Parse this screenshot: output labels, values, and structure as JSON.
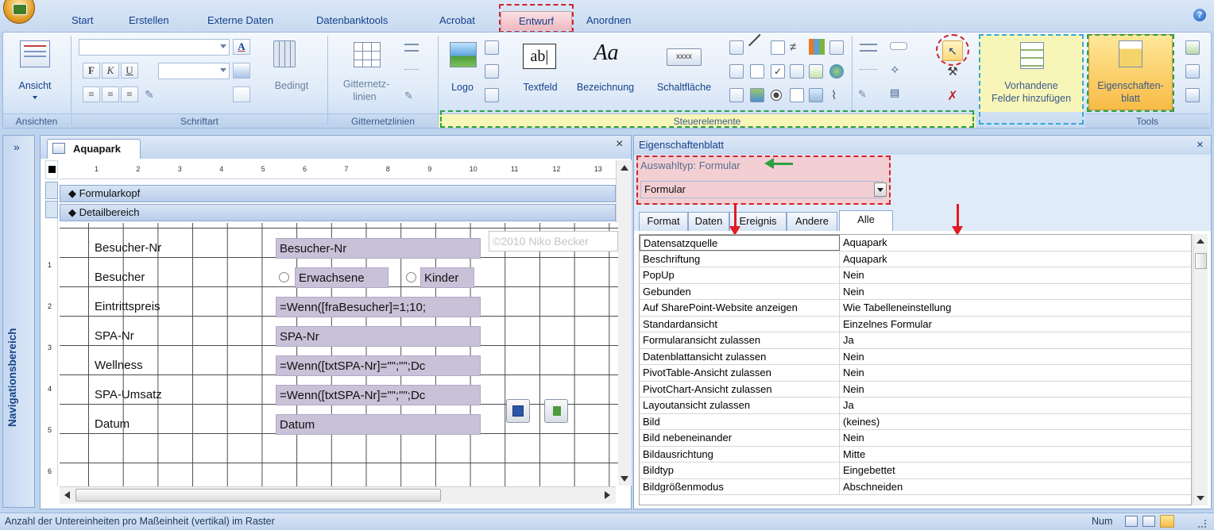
{
  "tabs": [
    "Start",
    "Erstellen",
    "Externe Daten",
    "Datenbanktools",
    "Acrobat",
    "Entwurf",
    "Anordnen"
  ],
  "active_tab": "Entwurf",
  "ribbon": {
    "ansichten": {
      "button": "Ansicht",
      "group": "Ansichten"
    },
    "schriftart": {
      "group": "Schriftart",
      "bold": "F",
      "italic": "K",
      "underline": "U",
      "bedingt": "Bedingt"
    },
    "gitternetz": {
      "button_line1": "Gitternetz-",
      "button_line2": "linien",
      "group": "Gitternetzlinien"
    },
    "steuerelemente": {
      "logo": "Logo",
      "textfeld": "Textfeld",
      "bezeichnung": "Bezeichnung",
      "schaltflaeche": "Schaltfläche",
      "textfeld_glyph": "ab|",
      "bezeichnung_glyph": "Aa",
      "schaltflaeche_glyph": "xxxx",
      "group": "Steuerelemente"
    },
    "tools": {
      "vorhandene_line1": "Vorhandene",
      "vorhandene_line2": "Felder hinzufügen",
      "eigenschaften_line1": "Eigenschaften-",
      "eigenschaften_line2": "blatt",
      "group": "Tools"
    }
  },
  "nav_pane": {
    "title": "Navigationsbereich",
    "collapse": "»"
  },
  "document": {
    "tab_title": "Aquapark",
    "close": "×",
    "sections": {
      "header": "Formularkopf",
      "detail": "Detailbereich"
    },
    "ruler_numbers": [
      "1",
      "2",
      "3",
      "4",
      "5",
      "6",
      "7",
      "8",
      "9",
      "10",
      "11",
      "12",
      "13"
    ],
    "vruler_numbers": [
      "1",
      "2",
      "3",
      "4",
      "5",
      "6"
    ],
    "watermark": "©2010 Niko Becker",
    "labels": [
      "Besucher-Nr",
      "Besucher",
      "Eintrittspreis",
      "SPA-Nr",
      "Wellness",
      "SPA-Umsatz",
      "Datum"
    ],
    "fields": {
      "besucher_nr": "Besucher-Nr",
      "option_erwachsene": "Erwachsene",
      "option_kinder": "Kinder",
      "eintrittspreis": "=Wenn([fraBesucher]=1;10;",
      "spa_nr": "SPA-Nr",
      "wellness": "=Wenn([txtSPA-Nr]=\"\";\"\";Dc",
      "spa_umsatz": "=Wenn([txtSPA-Nr]=\"\";\"\";Dc",
      "datum": "Datum"
    }
  },
  "property_sheet": {
    "title": "Eigenschaftenblatt",
    "close": "×",
    "selection_type": "Auswahltyp:  Formular",
    "selector_value": "Formular",
    "tabs": [
      "Format",
      "Daten",
      "Ereignis",
      "Andere",
      "Alle"
    ],
    "active_tab": "Alle",
    "rows": [
      {
        "k": "Datensatzquelle",
        "v": "Aquapark"
      },
      {
        "k": "Beschriftung",
        "v": "Aquapark"
      },
      {
        "k": "PopUp",
        "v": "Nein"
      },
      {
        "k": "Gebunden",
        "v": "Nein"
      },
      {
        "k": "Auf SharePoint-Website anzeigen",
        "v": "Wie Tabelleneinstellung"
      },
      {
        "k": "Standardansicht",
        "v": "Einzelnes Formular"
      },
      {
        "k": "Formularansicht zulassen",
        "v": "Ja"
      },
      {
        "k": "Datenblattansicht zulassen",
        "v": "Nein"
      },
      {
        "k": "PivotTable-Ansicht zulassen",
        "v": "Nein"
      },
      {
        "k": "PivotChart-Ansicht zulassen",
        "v": "Nein"
      },
      {
        "k": "Layoutansicht zulassen",
        "v": "Ja"
      },
      {
        "k": "Bild",
        "v": "(keines)"
      },
      {
        "k": "Bild nebeneinander",
        "v": "Nein"
      },
      {
        "k": "Bildausrichtung",
        "v": "Mitte"
      },
      {
        "k": "Bildtyp",
        "v": "Eingebettet"
      },
      {
        "k": "Bildgrößenmodus",
        "v": "Abschneiden"
      }
    ]
  },
  "status_bar": {
    "message": "Anzahl der Untereinheiten pro Maßeinheit (vertikal) im Raster",
    "num": "Num"
  },
  "colors": {
    "annotation_green": "#2ea043",
    "annotation_red": "#d0232c",
    "annotation_blue": "#39a7d8",
    "highlight_yellow": "#f7f5b8",
    "highlight_pink": "#f3cfd3",
    "field_fill": "#c9c1d8"
  }
}
